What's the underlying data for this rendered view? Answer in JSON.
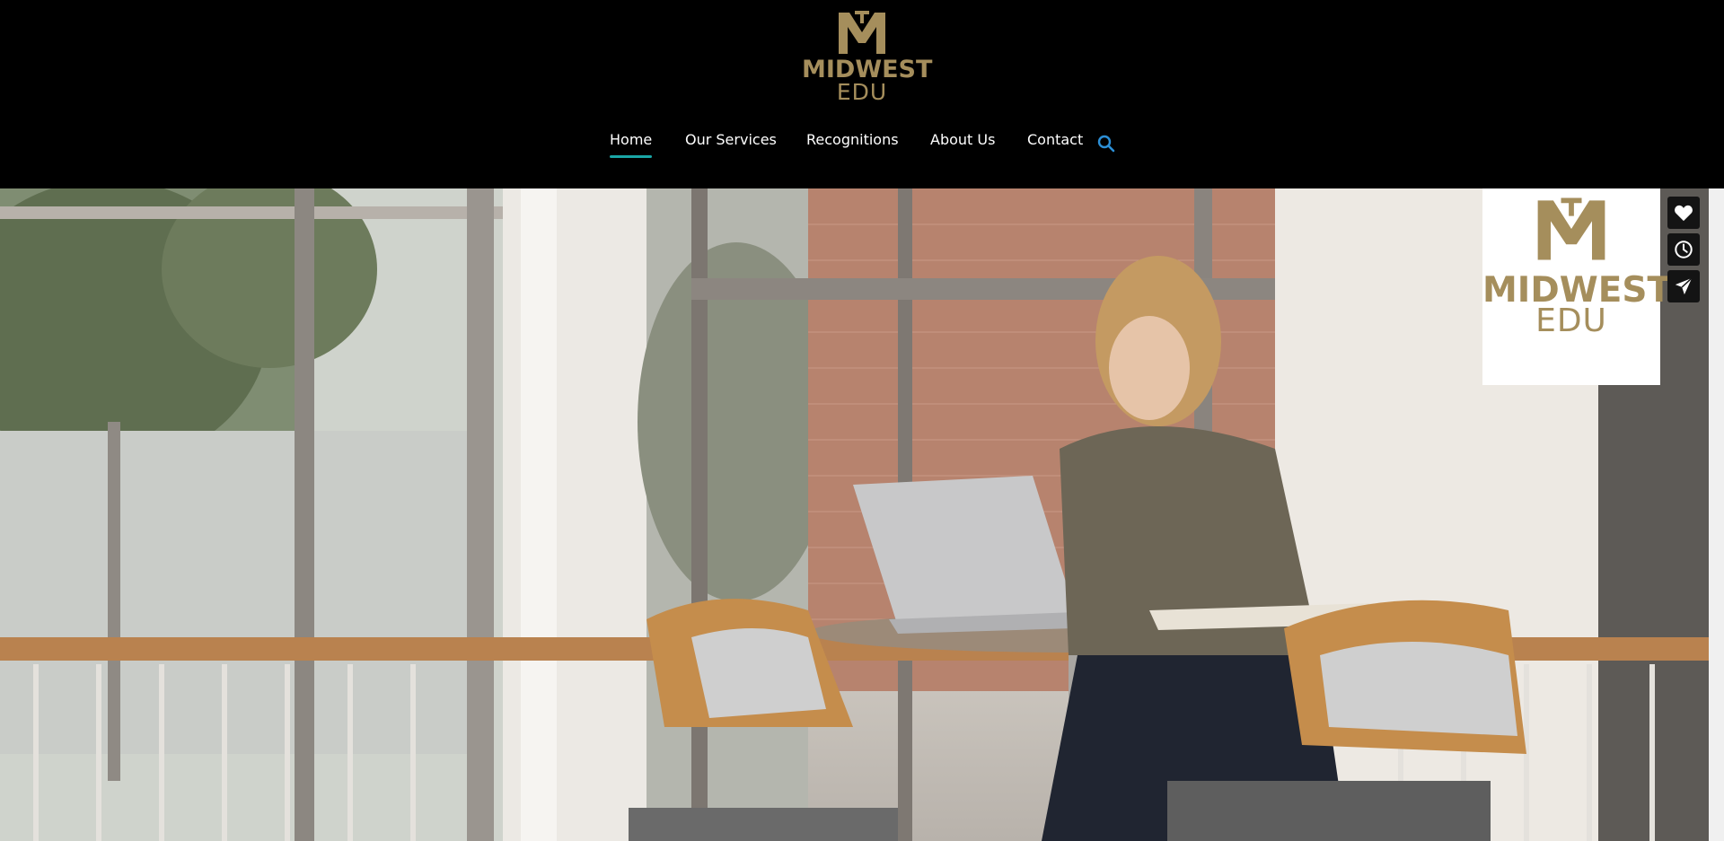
{
  "brand": {
    "line1": "MIDWEST",
    "line2": "EDU",
    "color": "#a58e5c"
  },
  "nav": {
    "items": [
      {
        "label": "Home",
        "active": true
      },
      {
        "label": "Our Services",
        "active": false
      },
      {
        "label": "Recognitions",
        "active": false
      },
      {
        "label": "About Us",
        "active": false
      },
      {
        "label": "Contact",
        "active": false
      }
    ],
    "accent": "#1aa6a6",
    "search_icon": "search-icon"
  },
  "hero": {
    "image": "student-with-laptop-photo"
  },
  "side_buttons": [
    {
      "icon": "heart-icon"
    },
    {
      "icon": "clock-icon"
    },
    {
      "icon": "send-icon"
    }
  ]
}
